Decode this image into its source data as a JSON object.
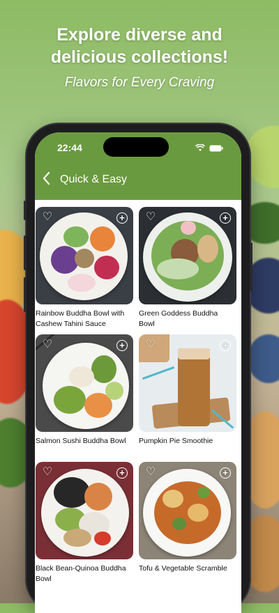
{
  "hero": {
    "title_line1": "Explore diverse and",
    "title_line2": "delicious collections!",
    "subtitle": "Flavors for Every Craving"
  },
  "status_bar": {
    "time": "22:44"
  },
  "header": {
    "back_icon": "chevron-left-icon",
    "title": "Quick & Easy"
  },
  "recipes": [
    {
      "title": "Rainbow Buddha Bowl with Cashew Tahini Sauce"
    },
    {
      "title": "Green Goddess Buddha Bowl"
    },
    {
      "title": "Salmon Sushi Buddha Bowl"
    },
    {
      "title": "Pumpkin Pie Smoothie"
    },
    {
      "title": "Black Bean-Quinoa Buddha Bowl"
    },
    {
      "title": "Tofu & Vegetable Scramble"
    }
  ],
  "colors": {
    "header": "#6a9a3f",
    "background": "#8dbb63"
  }
}
